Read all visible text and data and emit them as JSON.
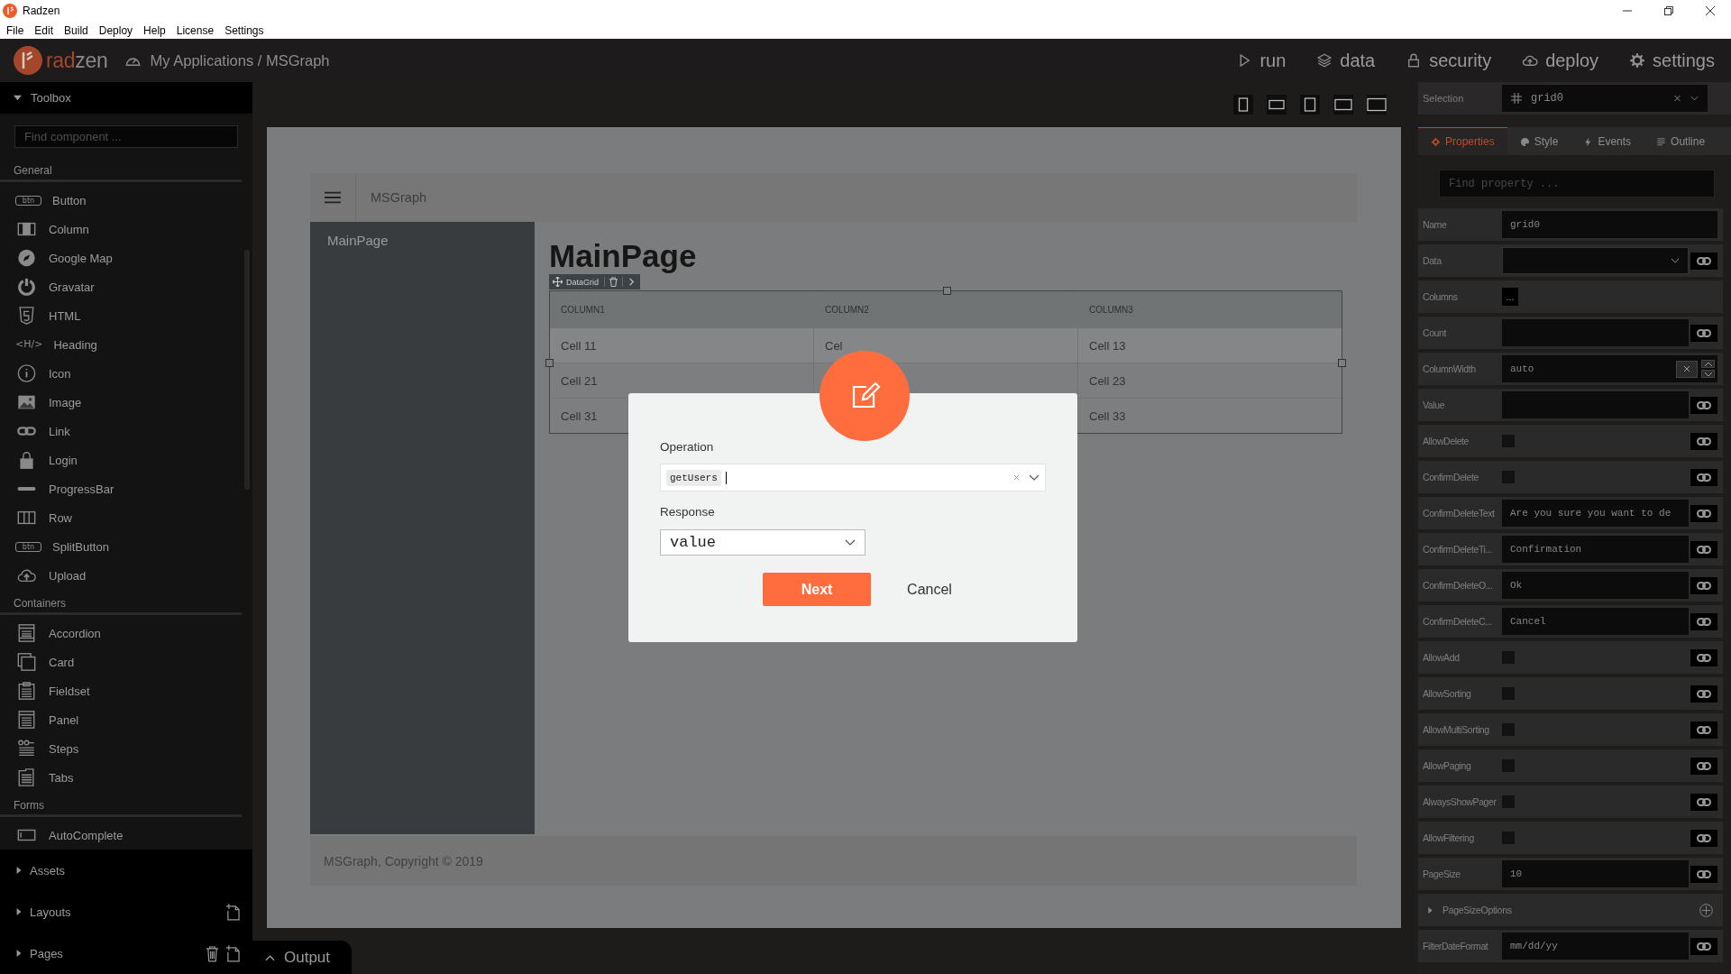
{
  "window": {
    "title": "Radzen"
  },
  "menu": [
    "File",
    "Edit",
    "Build",
    "Deploy",
    "Help",
    "License",
    "Settings"
  ],
  "header": {
    "logo_accent": "rad",
    "logo_rest": "zen",
    "breadcrumb": "My Applications / MSGraph",
    "nav": [
      "run",
      "data",
      "security",
      "deploy",
      "settings"
    ]
  },
  "toolbox": {
    "title": "Toolbox",
    "expanded": true,
    "search": {
      "placeholder": "Find component ..."
    },
    "groups": [
      {
        "title": "General",
        "items": [
          {
            "label": "Button",
            "icon_text": "btn"
          },
          {
            "label": "Column"
          },
          {
            "label": "Google Map"
          },
          {
            "label": "Gravatar"
          },
          {
            "label": "HTML"
          },
          {
            "label": "Heading",
            "icon_text": "<H/>"
          },
          {
            "label": "Icon"
          },
          {
            "label": "Image"
          },
          {
            "label": "Link"
          },
          {
            "label": "Login"
          },
          {
            "label": "ProgressBar"
          },
          {
            "label": "Row"
          },
          {
            "label": "SplitButton",
            "icon_text": "btn"
          },
          {
            "label": "Upload"
          }
        ]
      },
      {
        "title": "Containers",
        "items": [
          {
            "label": "Accordion"
          },
          {
            "label": "Card"
          },
          {
            "label": "Fieldset"
          },
          {
            "label": "Panel"
          },
          {
            "label": "Steps"
          },
          {
            "label": "Tabs"
          }
        ]
      },
      {
        "title": "Forms",
        "items": [
          {
            "label": "AutoComplete"
          }
        ]
      }
    ]
  },
  "panels": [
    {
      "label": "Assets",
      "expanded": false
    },
    {
      "label": "Layouts",
      "expanded": false
    },
    {
      "label": "Pages",
      "expanded": false
    }
  ],
  "preview": {
    "app_title": "MSGraph",
    "nav": [
      "MainPage"
    ],
    "heading": "MainPage",
    "grid_toolbar": "DataGrid",
    "columns": [
      "COLUMN1",
      "COLUMN2",
      "COLUMN3"
    ],
    "rows": [
      {
        "column1": "Cell 11",
        "column2": "Cel",
        "column3": "Cell 13"
      },
      {
        "column1": "Cell 21",
        "column3": "Cell 23"
      },
      {
        "column1": "Cell 31",
        "column3": "Cell 33"
      }
    ],
    "footer": "MSGraph, Copyright © 2019"
  },
  "output": {
    "label": "Output",
    "expanded": false
  },
  "dialog": {
    "operation": {
      "label": "Operation",
      "chips": [
        "getUsers"
      ]
    },
    "response": {
      "label": "Response",
      "value": "value"
    },
    "buttons": [
      {
        "label": "Next",
        "kind": "primary"
      },
      {
        "label": "Cancel",
        "kind": "link"
      }
    ]
  },
  "inspector": {
    "selection_label": "Selection",
    "selection": "grid0",
    "tabs": [
      {
        "label": "Properties",
        "selected": true
      },
      {
        "label": "Style",
        "selected": false
      },
      {
        "label": "Events",
        "selected": false
      },
      {
        "label": "Outline",
        "selected": false
      }
    ],
    "search": {
      "placeholder": "Find property ..."
    },
    "properties": [
      {
        "label": "Name",
        "kind": "input",
        "value": "grid0",
        "bindable": false
      },
      {
        "label": "Data",
        "kind": "dropdown",
        "bindable": true
      },
      {
        "label": "Columns",
        "kind": "button",
        "value": "..."
      },
      {
        "label": "Count",
        "kind": "input",
        "bindable": true
      },
      {
        "label": "ColumnWidth",
        "kind": "spin",
        "value": "auto"
      },
      {
        "label": "Value",
        "kind": "input",
        "bindable": true
      },
      {
        "label": "AllowDelete",
        "kind": "checkbox",
        "checked": false,
        "bindable": true
      },
      {
        "label": "ConfirmDelete",
        "kind": "checkbox",
        "checked": false,
        "bindable": true
      },
      {
        "label": "ConfirmDeleteText",
        "kind": "input",
        "value": "Are you sure you want to de",
        "bindable": true
      },
      {
        "label": "ConfirmDeleteTi...",
        "kind": "input",
        "value": "Confirmation",
        "bindable": true
      },
      {
        "label": "ConfirmDeleteO...",
        "kind": "input",
        "value": "Ok",
        "bindable": true
      },
      {
        "label": "ConfirmDeleteC...",
        "kind": "input",
        "value": "Cancel",
        "bindable": true
      },
      {
        "label": "AllowAdd",
        "kind": "checkbox",
        "checked": false,
        "bindable": true
      },
      {
        "label": "AllowSorting",
        "kind": "checkbox",
        "checked": false,
        "bindable": true
      },
      {
        "label": "AllowMultiSorting",
        "kind": "checkbox",
        "checked": false,
        "bindable": true
      },
      {
        "label": "AllowPaging",
        "kind": "checkbox",
        "checked": false,
        "bindable": true
      },
      {
        "label": "AlwaysShowPager",
        "kind": "checkbox",
        "checked": false,
        "bindable": true
      },
      {
        "label": "AllowFiltering",
        "kind": "checkbox",
        "checked": false,
        "bindable": true
      },
      {
        "label": "PageSize",
        "kind": "input",
        "value": "10",
        "bindable": true
      },
      {
        "label": "PageSizeOptions",
        "kind": "group",
        "expanded": false
      },
      {
        "label": "FilterDateFormat",
        "kind": "input",
        "value": "mm/dd/yy",
        "bindable": true
      }
    ]
  }
}
